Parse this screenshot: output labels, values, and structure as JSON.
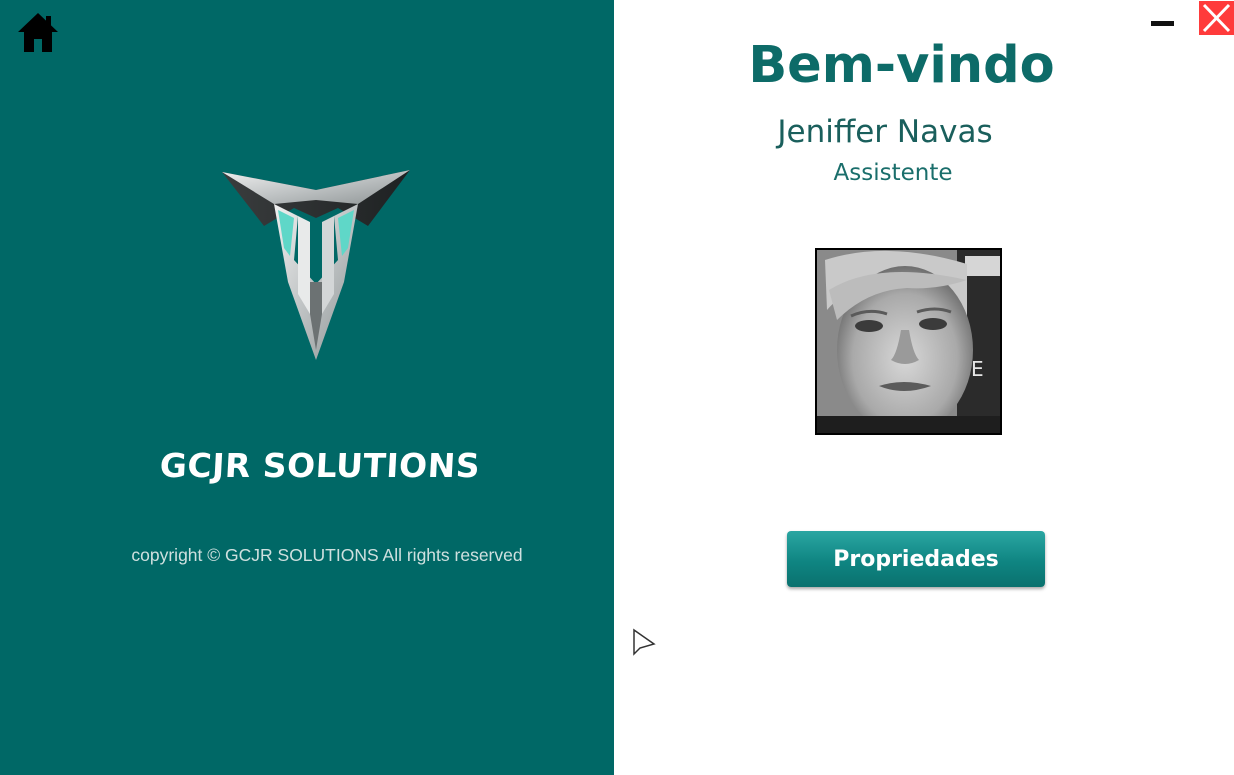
{
  "window": {
    "minimize_icon": "minimize-icon",
    "close_icon": "close-icon"
  },
  "left_panel": {
    "home_icon": "home-icon",
    "logo_icon": "gcjr-logo-icon",
    "brand_name": "GCJR SOLUTIONS",
    "copyright": "copyright © GCJR SOLUTIONS All rights reserved"
  },
  "right_panel": {
    "welcome_title": "Bem-vindo",
    "user_name": "Jeniffer Navas",
    "user_role": "Assistente",
    "avatar_icon": "user-photo",
    "properties_label": "Propriedades"
  },
  "colors": {
    "panel_teal": "#006866",
    "title_teal": "#0d6b68",
    "button_teal": "#0f8582",
    "close_red": "#ff3b3b"
  }
}
